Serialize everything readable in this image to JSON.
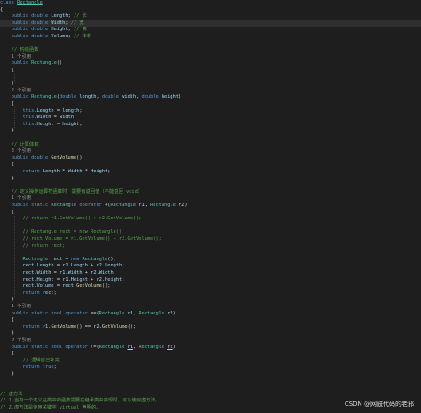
{
  "lines": [
    {
      "y": 0,
      "segs": [
        [
          "kw",
          "class "
        ],
        [
          "ty ul",
          "Rectangle"
        ]
      ]
    },
    {
      "y": 7.6,
      "segs": [
        [
          "pl",
          "{"
        ]
      ]
    },
    {
      "y": 15.2,
      "segs": [
        [
          "pl",
          "    "
        ],
        [
          "kw",
          "public double "
        ],
        [
          "pr",
          "Length"
        ],
        [
          "pl",
          "; "
        ],
        [
          "cm",
          "// 长"
        ]
      ]
    },
    {
      "y": 22.8,
      "hl": true,
      "segs": [
        [
          "pl",
          "    "
        ],
        [
          "kw",
          "public double "
        ],
        [
          "pr",
          "Width"
        ],
        [
          "pl",
          "; "
        ],
        [
          "cm",
          "// 宽"
        ]
      ]
    },
    {
      "y": 30.4,
      "segs": [
        [
          "pl",
          "    "
        ],
        [
          "kw",
          "public double "
        ],
        [
          "pr",
          "Height"
        ],
        [
          "pl",
          "; "
        ],
        [
          "cm",
          "// 高"
        ]
      ]
    },
    {
      "y": 38.0,
      "segs": [
        [
          "pl",
          "    "
        ],
        [
          "kw",
          "public double "
        ],
        [
          "pr",
          "Volume"
        ],
        [
          "pl",
          "; "
        ],
        [
          "cm",
          "// 体积"
        ]
      ]
    },
    {
      "y": 45.6,
      "segs": []
    },
    {
      "y": 53.2,
      "segs": [
        [
          "pl",
          "    "
        ],
        [
          "cm",
          "// 构造函数"
        ]
      ]
    },
    {
      "y": 60.8,
      "segs": [
        [
          "pl",
          "    "
        ],
        [
          "ref",
          "1 个引用"
        ]
      ]
    },
    {
      "y": 68.4,
      "segs": [
        [
          "pl",
          "    "
        ],
        [
          "kw",
          "public "
        ],
        [
          "ty",
          "Rectangle"
        ],
        [
          "pl",
          "()"
        ]
      ]
    },
    {
      "y": 76.0,
      "segs": [
        [
          "pl",
          "    {"
        ]
      ]
    },
    {
      "y": 83.6,
      "segs": []
    },
    {
      "y": 91.2,
      "segs": [
        [
          "pl",
          "    }"
        ]
      ]
    },
    {
      "y": 98.8,
      "segs": [
        [
          "pl",
          "    "
        ],
        [
          "ref",
          "2 个引用"
        ]
      ]
    },
    {
      "y": 106.4,
      "segs": [
        [
          "pl",
          "    "
        ],
        [
          "kw",
          "public "
        ],
        [
          "ty",
          "Rectangle"
        ],
        [
          "pl",
          "("
        ],
        [
          "kw",
          "double "
        ],
        [
          "pa",
          "length"
        ],
        [
          "pl",
          ", "
        ],
        [
          "kw",
          "double "
        ],
        [
          "pa",
          "width"
        ],
        [
          "pl",
          ", "
        ],
        [
          "kw",
          "double "
        ],
        [
          "pa",
          "height"
        ],
        [
          "pl",
          ")"
        ]
      ]
    },
    {
      "y": 114.0,
      "segs": [
        [
          "pl",
          "    {"
        ]
      ]
    },
    {
      "y": 121.6,
      "segs": [
        [
          "pl",
          "        "
        ],
        [
          "kw",
          "this"
        ],
        [
          "pl",
          "."
        ],
        [
          "pr",
          "Length"
        ],
        [
          "pl",
          " = "
        ],
        [
          "pa",
          "length"
        ],
        [
          "pl",
          ";"
        ]
      ]
    },
    {
      "y": 129.2,
      "segs": [
        [
          "pl",
          "        "
        ],
        [
          "kw",
          "this"
        ],
        [
          "pl",
          "."
        ],
        [
          "pr",
          "Width"
        ],
        [
          "pl",
          " = "
        ],
        [
          "pa",
          "width"
        ],
        [
          "pl",
          ";"
        ]
      ]
    },
    {
      "y": 136.8,
      "segs": [
        [
          "pl",
          "        "
        ],
        [
          "kw",
          "this"
        ],
        [
          "pl",
          "."
        ],
        [
          "pr",
          "Height"
        ],
        [
          "pl",
          " = "
        ],
        [
          "pa",
          "height"
        ],
        [
          "pl",
          ";"
        ]
      ]
    },
    {
      "y": 144.4,
      "segs": [
        [
          "pl",
          "    }"
        ]
      ]
    },
    {
      "y": 152.0,
      "segs": []
    },
    {
      "y": 159.6,
      "segs": [
        [
          "pl",
          "    "
        ],
        [
          "cm",
          "// 计算体积"
        ]
      ]
    },
    {
      "y": 167.2,
      "segs": [
        [
          "pl",
          "    "
        ],
        [
          "ref",
          "3 个引用"
        ]
      ]
    },
    {
      "y": 174.8,
      "segs": [
        [
          "pl",
          "    "
        ],
        [
          "kw",
          "public double "
        ],
        [
          "fn",
          "GetVolume"
        ],
        [
          "pl",
          "()"
        ]
      ]
    },
    {
      "y": 182.4,
      "segs": [
        [
          "pl",
          "    {"
        ]
      ]
    },
    {
      "y": 190.0,
      "segs": [
        [
          "pl",
          "        "
        ],
        [
          "kw",
          "return "
        ],
        [
          "pr",
          "Length"
        ],
        [
          "pl",
          " * "
        ],
        [
          "pr",
          "Width"
        ],
        [
          "pl",
          " * "
        ],
        [
          "pr",
          "Height"
        ],
        [
          "pl",
          ";"
        ]
      ]
    },
    {
      "y": 197.6,
      "segs": [
        [
          "pl",
          "    }"
        ]
      ]
    },
    {
      "y": 205.2,
      "segs": []
    },
    {
      "y": 212.8,
      "segs": [
        [
          "pl",
          "    "
        ],
        [
          "cm",
          "// 定义操作运算符函数时，需要有返回值（不能返回 void）"
        ]
      ]
    },
    {
      "y": 220.4,
      "segs": [
        [
          "pl",
          "    "
        ],
        [
          "ref",
          "1 个引用"
        ]
      ]
    },
    {
      "y": 228.0,
      "segs": [
        [
          "pl",
          "    "
        ],
        [
          "kw",
          "public static "
        ],
        [
          "ty",
          "Rectangle "
        ],
        [
          "kw",
          "operator "
        ],
        [
          "pl",
          "+("
        ],
        [
          "ty",
          "Rectangle "
        ],
        [
          "pa",
          "r1"
        ],
        [
          "pl",
          ", "
        ],
        [
          "ty",
          "Rectangle "
        ],
        [
          "pa",
          "r2"
        ],
        [
          "pl",
          ")"
        ]
      ]
    },
    {
      "y": 235.6,
      "segs": [
        [
          "pl",
          "    {"
        ]
      ]
    },
    {
      "y": 243.2,
      "segs": [
        [
          "pl",
          "        "
        ],
        [
          "cm",
          "// return r1.GetVolume() + r2.GetVolume();"
        ]
      ]
    },
    {
      "y": 250.8,
      "segs": []
    },
    {
      "y": 258.4,
      "segs": [
        [
          "pl",
          "        "
        ],
        [
          "cm",
          "// Rectangle rect = new Rectangle();"
        ]
      ]
    },
    {
      "y": 266.0,
      "segs": [
        [
          "pl",
          "        "
        ],
        [
          "cm",
          "// rect.Volume = r1.GetVolume() + r2.GetVolume();"
        ]
      ]
    },
    {
      "y": 273.6,
      "segs": [
        [
          "pl",
          "        "
        ],
        [
          "cm",
          "// return rect;"
        ]
      ]
    },
    {
      "y": 281.2,
      "segs": []
    },
    {
      "y": 288.8,
      "segs": [
        [
          "pl",
          "        "
        ],
        [
          "ty",
          "Rectangle "
        ],
        [
          "pa",
          "rect"
        ],
        [
          "pl",
          " = "
        ],
        [
          "kw",
          "new "
        ],
        [
          "ty",
          "Rectangle"
        ],
        [
          "pl",
          "();"
        ]
      ]
    },
    {
      "y": 296.4,
      "segs": [
        [
          "pl",
          "        "
        ],
        [
          "pa",
          "rect"
        ],
        [
          "pl",
          "."
        ],
        [
          "pr",
          "Length"
        ],
        [
          "pl",
          " = "
        ],
        [
          "pa",
          "r1"
        ],
        [
          "pl",
          "."
        ],
        [
          "pr",
          "Length"
        ],
        [
          "pl",
          " + "
        ],
        [
          "pa",
          "r2"
        ],
        [
          "pl",
          "."
        ],
        [
          "pr",
          "Length"
        ],
        [
          "pl",
          ";"
        ]
      ]
    },
    {
      "y": 304.0,
      "segs": [
        [
          "pl",
          "        "
        ],
        [
          "pa",
          "rect"
        ],
        [
          "pl",
          "."
        ],
        [
          "pr",
          "Width"
        ],
        [
          "pl",
          " = "
        ],
        [
          "pa",
          "r1"
        ],
        [
          "pl",
          "."
        ],
        [
          "pr",
          "Width"
        ],
        [
          "pl",
          " + "
        ],
        [
          "pa",
          "r2"
        ],
        [
          "pl",
          "."
        ],
        [
          "pr",
          "Width"
        ],
        [
          "pl",
          ";"
        ]
      ]
    },
    {
      "y": 311.6,
      "segs": [
        [
          "pl",
          "        "
        ],
        [
          "pa",
          "rect"
        ],
        [
          "pl",
          "."
        ],
        [
          "pr",
          "Height"
        ],
        [
          "pl",
          " = "
        ],
        [
          "pa",
          "r1"
        ],
        [
          "pl",
          "."
        ],
        [
          "pr",
          "Height"
        ],
        [
          "pl",
          " + "
        ],
        [
          "pa",
          "r2"
        ],
        [
          "pl",
          "."
        ],
        [
          "pr",
          "Height"
        ],
        [
          "pl",
          ";"
        ]
      ]
    },
    {
      "y": 319.2,
      "segs": [
        [
          "pl",
          "        "
        ],
        [
          "pa",
          "rect"
        ],
        [
          "pl",
          "."
        ],
        [
          "pr",
          "Volume"
        ],
        [
          "pl",
          " = "
        ],
        [
          "pa",
          "rect"
        ],
        [
          "pl",
          "."
        ],
        [
          "fn",
          "GetVolume"
        ],
        [
          "pl",
          "();"
        ]
      ]
    },
    {
      "y": 326.8,
      "segs": [
        [
          "pl",
          "        "
        ],
        [
          "kw",
          "return "
        ],
        [
          "pa",
          "rect"
        ],
        [
          "pl",
          ";"
        ]
      ]
    },
    {
      "y": 334.4,
      "segs": [
        [
          "pl",
          "    }"
        ]
      ]
    },
    {
      "y": 342.0,
      "segs": [
        [
          "pl",
          "    "
        ],
        [
          "ref",
          "1 个引用"
        ]
      ]
    },
    {
      "y": 349.6,
      "segs": [
        [
          "pl",
          "    "
        ],
        [
          "kw",
          "public static bool operator "
        ],
        [
          "pl",
          "==("
        ],
        [
          "ty",
          "Rectangle "
        ],
        [
          "pa",
          "r1"
        ],
        [
          "pl",
          ", "
        ],
        [
          "ty",
          "Rectangle "
        ],
        [
          "pa",
          "r2"
        ],
        [
          "pl",
          ")"
        ]
      ]
    },
    {
      "y": 357.2,
      "segs": [
        [
          "pl",
          "    {"
        ]
      ]
    },
    {
      "y": 364.8,
      "segs": [
        [
          "pl",
          "        "
        ],
        [
          "kw",
          "return "
        ],
        [
          "pa",
          "r1"
        ],
        [
          "pl",
          "."
        ],
        [
          "fn",
          "GetVolume"
        ],
        [
          "pl",
          "() == "
        ],
        [
          "pa",
          "r2"
        ],
        [
          "pl",
          "."
        ],
        [
          "fn",
          "GetVolume"
        ],
        [
          "pl",
          "();"
        ]
      ]
    },
    {
      "y": 372.4,
      "segs": [
        [
          "pl",
          "    }"
        ]
      ]
    },
    {
      "y": 380.0,
      "segs": [
        [
          "pl",
          "    "
        ],
        [
          "ref",
          "0 个引用"
        ]
      ]
    },
    {
      "y": 387.6,
      "segs": [
        [
          "pl",
          "    "
        ],
        [
          "kw",
          "public static bool operator "
        ],
        [
          "pl",
          "!=("
        ],
        [
          "ty",
          "Rectangle "
        ],
        [
          "pa ul",
          "r1"
        ],
        [
          "pl",
          ", "
        ],
        [
          "ty",
          "Rectangle "
        ],
        [
          "pa ul",
          "r2"
        ],
        [
          "pl",
          ")"
        ]
      ]
    },
    {
      "y": 395.2,
      "segs": [
        [
          "pl",
          "    {"
        ]
      ]
    },
    {
      "y": 402.8,
      "segs": [
        [
          "pl",
          "        "
        ],
        [
          "cm",
          "// 逻辑自己补充"
        ]
      ]
    },
    {
      "y": 410.4,
      "segs": [
        [
          "pl",
          "        "
        ],
        [
          "kw",
          "return true"
        ],
        [
          "pl",
          ";"
        ]
      ]
    },
    {
      "y": 418.0,
      "segs": [
        [
          "pl",
          "    }"
        ]
      ]
    },
    {
      "y": 425.6,
      "segs": []
    },
    {
      "y": 433.2,
      "segs": []
    },
    {
      "y": 440.8,
      "segs": [
        [
          "cm",
          "// 虚方法"
        ]
      ]
    },
    {
      "y": 448.4,
      "segs": [
        [
          "cm",
          "// 1.当有一个定义在类中的函数需要在继承类中实现时，可以使用虚方法。"
        ]
      ]
    },
    {
      "y": 456.0,
      "segs": [
        [
          "cm",
          "// 2.虚方法是使用关键字 virtual 声明的。"
        ]
      ]
    }
  ],
  "watermark": "CSDN @网鼓代码的老邪"
}
